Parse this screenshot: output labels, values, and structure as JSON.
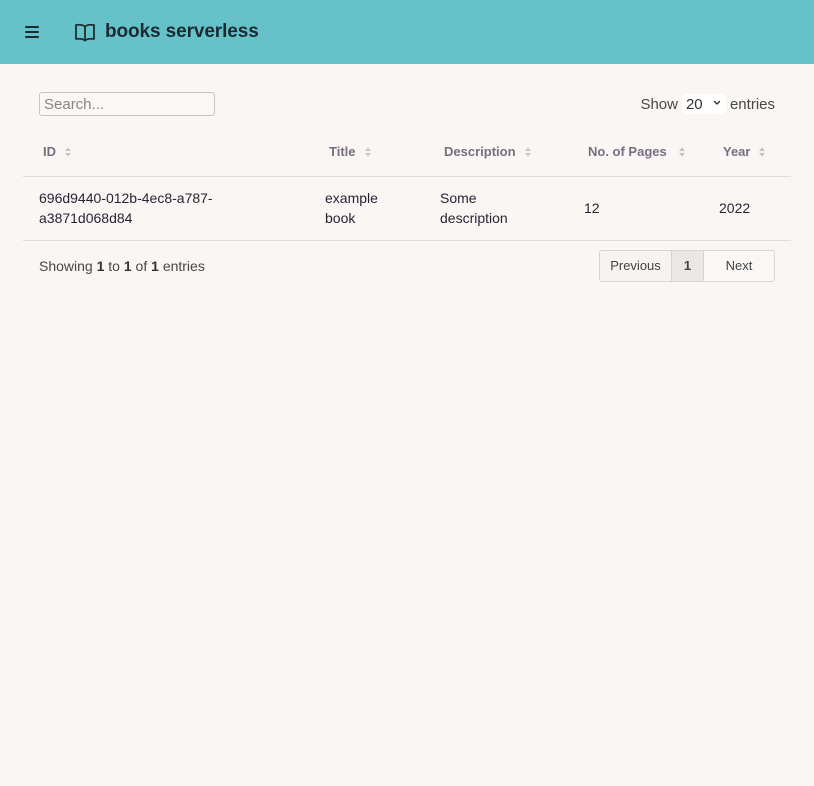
{
  "header": {
    "menu_icon": "hamburger-menu-icon",
    "logo_icon": "open-book-icon",
    "title": "books serverless",
    "bar_color": "#66c2c8"
  },
  "controls": {
    "search_placeholder": "Search...",
    "show_label": "Show",
    "page_size": "20",
    "entries_label": "entries"
  },
  "table": {
    "columns": [
      "ID",
      "Title",
      "Description",
      "No. of Pages",
      "Year"
    ],
    "rows": [
      {
        "id_line1": "696d9440-012b-4ec8-a787-",
        "id_line2": "a3871d068d84",
        "title_line1": "example",
        "title_line2": "book",
        "desc_line1": "Some",
        "desc_line2": "description",
        "pages": "12",
        "year": "2022"
      }
    ]
  },
  "footer": {
    "showing": "Showing",
    "from": "1",
    "to_label": "to",
    "to": "1",
    "of_label": "of",
    "total": "1",
    "entries_label": "entries"
  },
  "pagination": {
    "previous": "Previous",
    "current": "1",
    "next": "Next"
  }
}
